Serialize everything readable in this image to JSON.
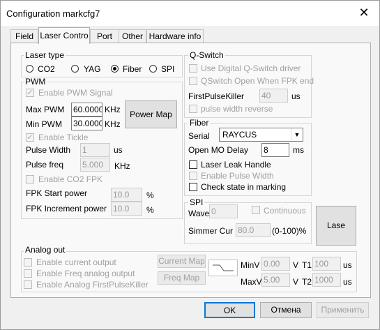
{
  "window": {
    "title": "Configuration markcfg7",
    "close_glyph": "✕"
  },
  "tabs": [
    "Field",
    "Laser Contro",
    "Port",
    "Other",
    "Hardware info"
  ],
  "laser_type": {
    "title": "Laser type",
    "options": [
      "CO2",
      "YAG",
      "Fiber",
      "SPI"
    ],
    "selected": "Fiber"
  },
  "pwm": {
    "title": "PWM",
    "enable_pwm_signal": "Enable PWM Signal",
    "max_pwm_label": "Max PWM",
    "max_pwm_value": "60.0000",
    "max_pwm_unit": "KHz",
    "min_pwm_label": "Min PWM",
    "min_pwm_value": "30.0000",
    "min_pwm_unit": "KHz",
    "power_map_button": "Power Map",
    "enable_tickle": "Enable Tickle",
    "pulse_width_label": "Pulse Width",
    "pulse_width_value": "1",
    "pulse_width_unit": "us",
    "pulse_freq_label": "Pulse freq",
    "pulse_freq_value": "5.000",
    "pulse_freq_unit": "KHz",
    "enable_co2_fpk": "Enable CO2 FPK",
    "fpk_start_label": "FPK Start power",
    "fpk_start_value": "10.0",
    "fpk_start_unit": "%",
    "fpk_inc_label": "FPK Increment power",
    "fpk_inc_value": "10.0",
    "fpk_inc_unit": "%"
  },
  "qswitch": {
    "title": "Q-Switch",
    "use_digital": "Use Digital Q-Switch driver",
    "open_when_fpk": "QSwitch Open When FPK end",
    "first_pulse_label": "FirstPulseKiller",
    "first_pulse_value": "40",
    "first_pulse_unit": "us",
    "pulse_width_reverse": "pulse width reverse"
  },
  "fiber": {
    "title": "Fiber",
    "serial_label": "Serial",
    "serial_value": "RAYCUS",
    "open_mo_label": "Open MO Delay",
    "open_mo_value": "8",
    "open_mo_unit": "ms",
    "laser_leak": "Laser Leak Handle",
    "enable_pulse_width": "Enable Pulse Width",
    "check_state": "Check state in marking"
  },
  "spi": {
    "title": "SPI",
    "wave_label": "Wave",
    "wave_value": "0",
    "continuous": "Continuous",
    "simmer_label": "Simmer Cur",
    "simmer_value": "80.0",
    "simmer_unit": "(0-100)%"
  },
  "lase_button": "Lase",
  "analog": {
    "title": "Analog out",
    "enable_current": "Enable current output",
    "enable_freq": "Enable Freq analog output",
    "enable_fpk": "Enable Analog FirstPulseKiller",
    "current_map": "Current Map",
    "freq_map": "Freq Map",
    "minv_label": "MinV",
    "minv_value": "0.00",
    "maxv_label": "MaxV",
    "maxv_value": "5.00",
    "v1": "V",
    "v2": "V",
    "t1_label": "T1",
    "t1_value": "100",
    "t2_label": "T2",
    "t2_value": "1000",
    "t_unit": "us"
  },
  "footer": {
    "ok": "OK",
    "cancel": "Отмена",
    "apply": "Применить"
  },
  "icons": {
    "checkmark": "✓",
    "dropdown": "▼"
  }
}
